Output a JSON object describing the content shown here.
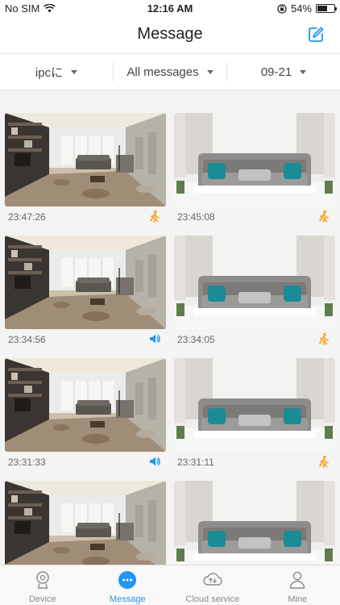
{
  "status_bar": {
    "carrier": "No SIM",
    "time": "12:16 AM",
    "battery": "54%",
    "battery_level": 0.54
  },
  "header": {
    "title": "Message",
    "edit_icon": "edit-icon"
  },
  "filters": [
    {
      "label": "ipcに"
    },
    {
      "label": "All messages"
    },
    {
      "label": "09-21"
    }
  ],
  "messages": [
    {
      "time": "23:47:26",
      "type": "motion",
      "image": "living-room"
    },
    {
      "time": "23:45:08",
      "type": "motion",
      "image": "sofa"
    },
    {
      "time": "23:34:56",
      "type": "sound",
      "image": "living-room"
    },
    {
      "time": "23:34:05",
      "type": "motion",
      "image": "sofa"
    },
    {
      "time": "23:31:33",
      "type": "sound",
      "image": "living-room"
    },
    {
      "time": "23:31:11",
      "type": "motion",
      "image": "sofa"
    },
    {
      "time": "",
      "type": "",
      "image": "living-room"
    },
    {
      "time": "",
      "type": "",
      "image": "sofa"
    }
  ],
  "tabs": [
    {
      "label": "Device",
      "icon": "camera-icon",
      "active": false
    },
    {
      "label": "Message",
      "icon": "message-icon",
      "active": true
    },
    {
      "label": "Cloud service",
      "icon": "cloud-icon",
      "active": false
    },
    {
      "label": "Mine",
      "icon": "person-icon",
      "active": false
    }
  ],
  "colors": {
    "accent": "#2196f3",
    "motion": "#f5a623",
    "sound": "#2196f3"
  }
}
